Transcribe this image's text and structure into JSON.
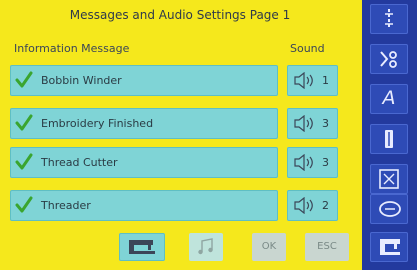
{
  "title": "Messages and Audio Settings Page 1",
  "columns": {
    "info": "Information Message",
    "sound": "Sound"
  },
  "messages": [
    {
      "label": "Bobbin Winder",
      "sound": "1"
    },
    {
      "label": "Embroidery Finished",
      "sound": "3"
    },
    {
      "label": "Thread Cutter",
      "sound": "3"
    },
    {
      "label": "Threader",
      "sound": "2"
    }
  ],
  "buttons": {
    "ok": "OK",
    "esc": "ESC"
  },
  "sidebar": {
    "text_icon_glyph": "A"
  },
  "colors": {
    "background": "#f5e81c",
    "row": "#7fd4d6",
    "sidebar": "#233a9e",
    "check": "#3aa52f"
  }
}
